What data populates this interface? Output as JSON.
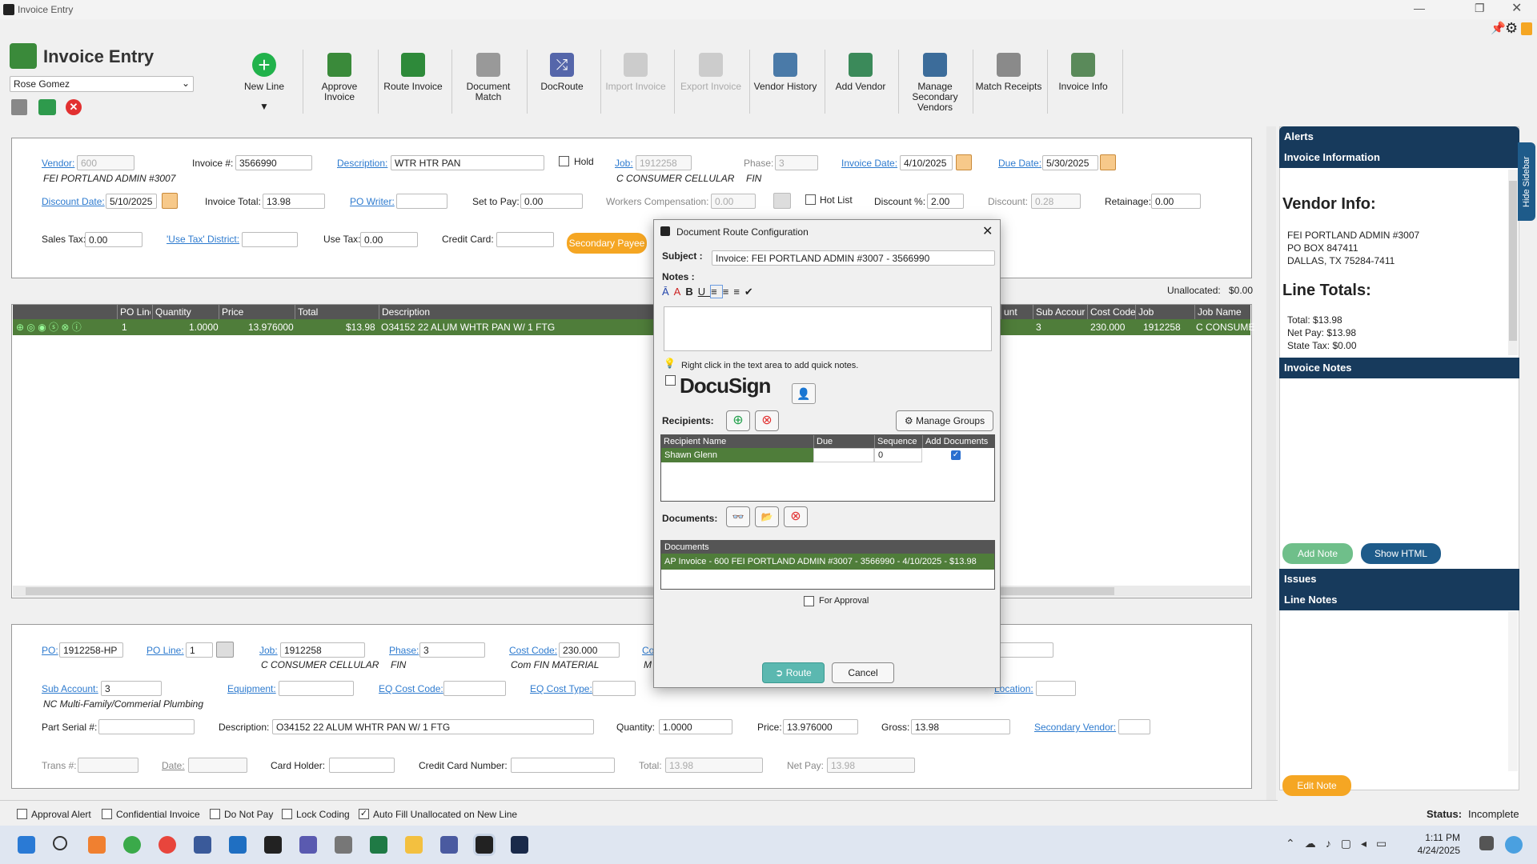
{
  "window": {
    "title": "Invoice Entry"
  },
  "header": {
    "app_title": "Invoice Entry",
    "user": "Rose Gomez"
  },
  "ribbon": {
    "new_line": "New Line",
    "approve": "Approve\nInvoice",
    "route": "Route Invoice",
    "doc_match": "Document\nMatch",
    "docroute": "DocRoute",
    "import": "Import Invoice",
    "export": "Export Invoice",
    "vendor_history": "Vendor History",
    "add_vendor": "Add Vendor",
    "manage_secondary": "Manage\nSecondary\nVendors",
    "match_receipts": "Match Receipts",
    "invoice_info": "Invoice Info"
  },
  "invoice": {
    "vendor_label": "Vendor:",
    "vendor_code": "600",
    "vendor_name": "FEI PORTLAND ADMIN #3007",
    "invoice_no_label": "Invoice #:",
    "invoice_no": "3566990",
    "description_label": "Description:",
    "description": "WTR HTR PAN",
    "hold_label": "Hold",
    "job_label": "Job:",
    "job": "1912258",
    "job_name": "C CONSUMER CELLULAR",
    "phase_label": "Phase:",
    "phase": "3",
    "phase_name": "FIN",
    "invoice_date_label": "Invoice Date:",
    "invoice_date": "4/10/2025",
    "due_date_label": "Due Date:",
    "due_date": "5/30/2025",
    "discount_date_label": "Discount Date:",
    "discount_date": "5/10/2025",
    "invoice_total_label": "Invoice Total:",
    "invoice_total": "13.98",
    "po_writer_label": "PO Writer:",
    "po_writer": "",
    "set_to_pay_label": "Set to Pay:",
    "set_to_pay": "0.00",
    "workers_comp_label": "Workers Compensation:",
    "workers_comp": "0.00",
    "hot_list_label": "Hot List",
    "discount_pct_label": "Discount %:",
    "discount_pct": "2.00",
    "discount_label": "Discount:",
    "discount": "0.28",
    "retainage_label": "Retainage:",
    "retainage": "0.00",
    "sales_tax_label": "Sales Tax:",
    "sales_tax": "0.00",
    "use_tax_district_label": "'Use Tax' District:",
    "use_tax_label": "Use Tax:",
    "use_tax": "0.00",
    "credit_card_label": "Credit Card:",
    "secondary_payee": "Secondary Payee"
  },
  "lines": {
    "unallocated_label": "Unallocated:",
    "unallocated": "$0.00",
    "columns": [
      "PO Line",
      "Quantity",
      "Price",
      "Total",
      "Description",
      "unt",
      "Sub Accour",
      "Cost Code",
      "Job",
      "Job Name"
    ],
    "row": {
      "po_line": "1",
      "quantity": "1.0000",
      "price": "13.976000",
      "total": "$13.98",
      "description": "O34152 22 ALUM WHTR PAN W/ 1 FTG",
      "sub_account": "3",
      "cost_code": "230.000",
      "job": "1912258",
      "job_name": "C CONSUME"
    }
  },
  "detail": {
    "po_label": "PO:",
    "po": "1912258-HP",
    "po_line_label": "PO Line:",
    "po_line": "1",
    "job_label": "Job:",
    "job": "1912258",
    "job_name": "C CONSUMER CELLULAR",
    "phase_label": "Phase:",
    "phase": "3",
    "phase_name": "FIN",
    "cost_code_label": "Cost Code:",
    "cost_code": "230.000",
    "cost_code_name": "Com FIN MATERIAL",
    "co_label": "Co",
    "co_name": "M",
    "sub_account_label": "Sub Account:",
    "sub_account": "3",
    "sub_account_name": "NC Multi-Family/Commerial Plumbing",
    "equipment_label": "Equipment:",
    "eq_cost_code_label": "EQ Cost Code:",
    "eq_cost_type_label": "EQ Cost Type:",
    "location_label": "Location:",
    "part_serial_label": "Part Serial #:",
    "description_label": "Description:",
    "description": "O34152 22 ALUM WHTR PAN W/ 1 FTG",
    "quantity_label": "Quantity:",
    "quantity": "1.0000",
    "price_label": "Price:",
    "price": "13.976000",
    "gross_label": "Gross:",
    "gross": "13.98",
    "secondary_vendor_label": "Secondary Vendor:",
    "trans_label": "Trans #:",
    "date_label": "Date:",
    "card_holder_label": "Card Holder:",
    "card_number_label": "Credit Card Number:",
    "total_label": "Total:",
    "total": "13.98",
    "net_pay_label": "Net Pay:",
    "net_pay": "13.98"
  },
  "footer": {
    "approval_alert": "Approval Alert",
    "confidential": "Confidential Invoice",
    "do_not_pay": "Do Not Pay",
    "lock_coding": "Lock Coding",
    "auto_fill": "Auto Fill Unallocated on New Line",
    "status_label": "Status:",
    "status": "Incomplete"
  },
  "sidebar": {
    "alerts": "Alerts",
    "invoice_information": "Invoice Information",
    "hide": "Hide Sidebar",
    "vendor_info_title": "Vendor Info:",
    "vendor_lines": [
      "FEI PORTLAND ADMIN #3007",
      "PO BOX 847411",
      "DALLAS, TX 75284-7411"
    ],
    "line_totals_title": "Line Totals:",
    "total_label": "Total:",
    "total": "$13.98",
    "net_pay_label": "Net Pay:",
    "net_pay": "$13.98",
    "state_tax_label": "State Tax:",
    "state_tax": "$0.00",
    "invoice_notes": "Invoice Notes",
    "add_note": "Add Note",
    "show_html": "Show HTML",
    "issues": "Issues",
    "line_notes": "Line Notes",
    "edit_note": "Edit Note"
  },
  "dialog": {
    "title": "Document Route Configuration",
    "subject_label": "Subject",
    "subject": "Invoice: FEI PORTLAND ADMIN #3007 - 3566990",
    "notes_label": "Notes",
    "hint": "Right click in the text area to add quick notes.",
    "docusign": "DocuSign",
    "recipients_label": "Recipients:",
    "manage_groups": "Manage Groups",
    "recipient_columns": [
      "Recipient Name",
      "Due",
      "Sequence",
      "Add Documents"
    ],
    "recipient": {
      "name": "Shawn Glenn",
      "due": "",
      "sequence": "0"
    },
    "documents_label": "Documents:",
    "documents_header": "Documents",
    "document": "AP Invoice - 600 FEI PORTLAND ADMIN #3007 - 3566990 - 4/10/2025 - $13.98",
    "for_approval": "For Approval",
    "route": "Route",
    "cancel": "Cancel"
  },
  "taskbar": {
    "time": "1:11 PM",
    "date": "4/24/2025"
  }
}
